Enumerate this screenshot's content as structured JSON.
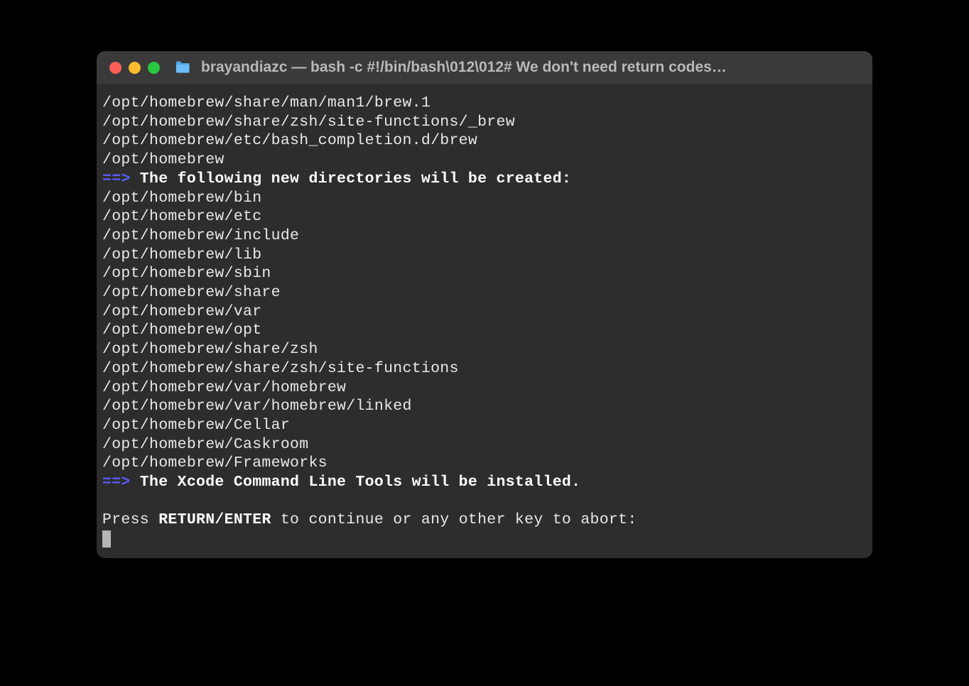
{
  "window": {
    "title": "brayandiazc — bash -c #!/bin/bash\\012\\012# We don't need return codes…"
  },
  "terminal": {
    "lines": [
      "/opt/homebrew/share/man/man1/brew.1",
      "/opt/homebrew/share/zsh/site-functions/_brew",
      "/opt/homebrew/etc/bash_completion.d/brew",
      "/opt/homebrew"
    ],
    "header1_arrow": "==>",
    "header1_text": " The following new directories will be created:",
    "dirs": [
      "/opt/homebrew/bin",
      "/opt/homebrew/etc",
      "/opt/homebrew/include",
      "/opt/homebrew/lib",
      "/opt/homebrew/sbin",
      "/opt/homebrew/share",
      "/opt/homebrew/var",
      "/opt/homebrew/opt",
      "/opt/homebrew/share/zsh",
      "/opt/homebrew/share/zsh/site-functions",
      "/opt/homebrew/var/homebrew",
      "/opt/homebrew/var/homebrew/linked",
      "/opt/homebrew/Cellar",
      "/opt/homebrew/Caskroom",
      "/opt/homebrew/Frameworks"
    ],
    "header2_arrow": "==>",
    "header2_text": " The Xcode Command Line Tools will be installed.",
    "prompt_pre": "Press ",
    "prompt_bold": "RETURN/ENTER",
    "prompt_post": " to continue or any other key to abort:"
  }
}
